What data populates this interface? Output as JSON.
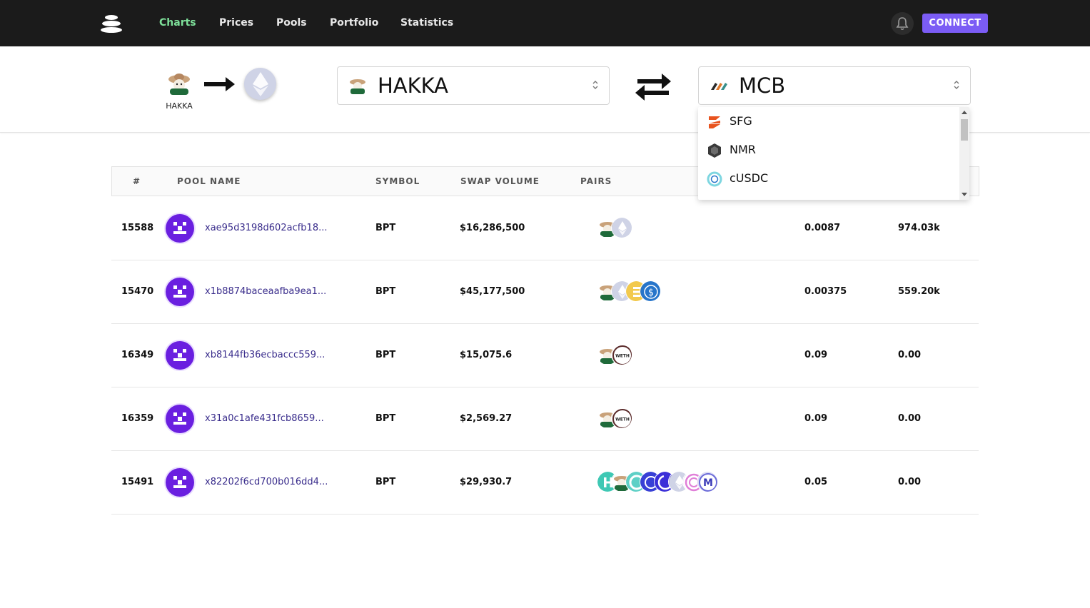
{
  "nav": {
    "links": [
      "Charts",
      "Prices",
      "Pools",
      "Portfolio",
      "Statistics"
    ],
    "active": "Charts",
    "connect_label": "CONNECT"
  },
  "selector": {
    "from_caption": "HAKKA",
    "from_token": "HAKKA",
    "to_token": "MCB",
    "dropdown_options": [
      "SFG",
      "NMR",
      "cUSDC"
    ]
  },
  "table": {
    "headers": [
      "#",
      "POOL NAME",
      "SYMBOL",
      "SWAP VOLUME",
      "PAIRS"
    ],
    "rows": [
      {
        "id": "15588",
        "name": "xae95d3198d602acfb18...",
        "symbol": "BPT",
        "volume": "$16,286,500",
        "pairs": [
          "hakka",
          "eth"
        ],
        "c6": "0.0087",
        "c7": "974.03k"
      },
      {
        "id": "15470",
        "name": "x1b8874baceaafba9ea1...",
        "symbol": "BPT",
        "volume": "$45,177,500",
        "pairs": [
          "hakka",
          "eth",
          "e-coin",
          "usdc"
        ],
        "c6": "0.00375",
        "c7": "559.20k"
      },
      {
        "id": "16349",
        "name": "xb8144fb36ecbaccc559...",
        "symbol": "BPT",
        "volume": "$15,075.6",
        "pairs": [
          "hakka",
          "weth"
        ],
        "c6": "0.09",
        "c7": "0.00"
      },
      {
        "id": "16359",
        "name": "x31a0c1afe431fcb8659...",
        "symbol": "BPT",
        "volume": "$2,569.27",
        "pairs": [
          "hakka",
          "weth"
        ],
        "c6": "0.09",
        "c7": "0.00"
      },
      {
        "id": "15491",
        "name": "x82202f6cd700b016dd4...",
        "symbol": "BPT",
        "volume": "$29,930.7",
        "pairs": [
          "teal-h",
          "hakka",
          "celo",
          "cusd",
          "blue-c",
          "eth",
          "pink-c",
          "mcb-m"
        ],
        "c6": "0.05",
        "c7": "0.00"
      }
    ]
  },
  "coin_text": {
    "weth": "WETH",
    "mcb-m": "M"
  }
}
